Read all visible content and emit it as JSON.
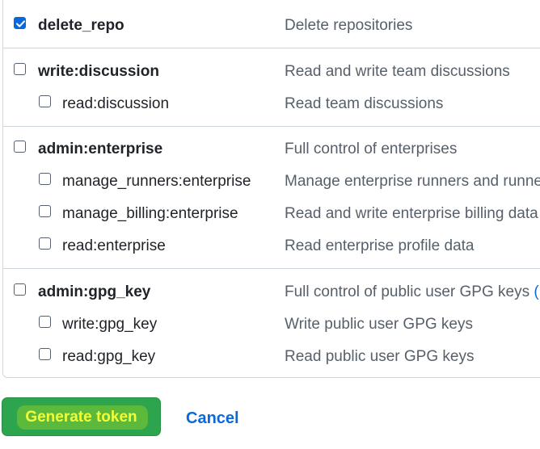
{
  "scopes": [
    {
      "name": "delete_repo",
      "description": "Delete repositories",
      "checked": true
    },
    {
      "name": "write:discussion",
      "description": "Read and write team discussions",
      "checked": false
    },
    {
      "name": "read:discussion",
      "description": "Read team discussions",
      "checked": false
    },
    {
      "name": "admin:enterprise",
      "description": "Full control of enterprises",
      "checked": false
    },
    {
      "name": "manage_runners:enterprise",
      "description": "Manage enterprise runners and runne",
      "checked": false
    },
    {
      "name": "manage_billing:enterprise",
      "description": "Read and write enterprise billing data",
      "checked": false
    },
    {
      "name": "read:enterprise",
      "description": "Read enterprise profile data",
      "checked": false
    },
    {
      "name": "admin:gpg_key",
      "description": "Full control of public user GPG keys",
      "description_suffix": "(",
      "checked": false
    },
    {
      "name": "write:gpg_key",
      "description": "Write public user GPG keys",
      "checked": false
    },
    {
      "name": "read:gpg_key",
      "description": "Read public user GPG keys",
      "checked": false
    }
  ],
  "actions": {
    "generate_label": "Generate token",
    "cancel_label": "Cancel"
  },
  "colors": {
    "accent": "#0969da",
    "primary_button": "#2da44e",
    "highlight_text": "#f1ff3a"
  },
  "icons": {
    "checkbox_checked": "check-icon"
  }
}
